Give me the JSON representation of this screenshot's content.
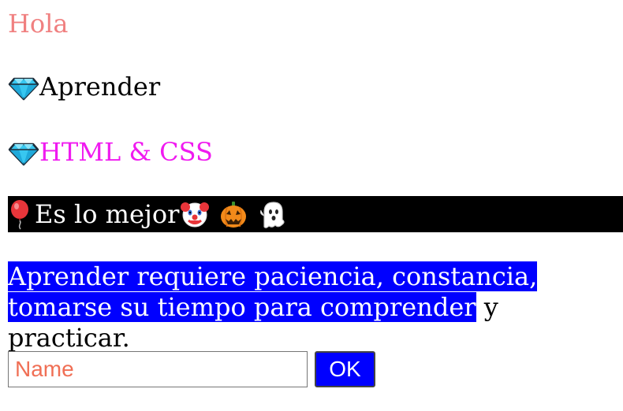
{
  "greeting": "Hola",
  "items": [
    {
      "icon": "gem-icon",
      "label": "Aprender"
    },
    {
      "icon": "gem-icon",
      "label": "HTML & CSS"
    }
  ],
  "banner": {
    "leading_icon": "balloon-icon",
    "text": "Es lo mejor",
    "trailing_icons": [
      "clown-face-icon",
      "jack-o-lantern-icon",
      "ghost-icon"
    ]
  },
  "paragraph": {
    "highlighted": "Aprender requiere paciencia, constancia, tomarse su tiempo para comprender",
    "rest": " y practicar."
  },
  "form": {
    "input_placeholder": "Name",
    "button_label": "OK"
  },
  "colors": {
    "greeting": "#F08080",
    "html_css": "#F01AF0",
    "banner_bg": "#000000",
    "highlight_bg": "#0000FF",
    "button_bg": "#0000FF",
    "placeholder": "#F06F55"
  }
}
